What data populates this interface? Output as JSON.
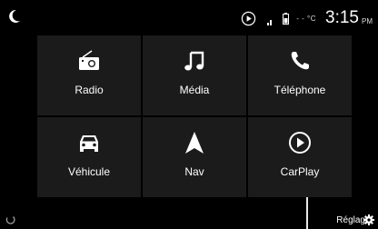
{
  "status": {
    "temp": "- - °C",
    "time": "3:15",
    "ampm": "PM"
  },
  "tiles": [
    {
      "label": "Radio",
      "icon": "radio-icon"
    },
    {
      "label": "Média",
      "icon": "music-note-icon"
    },
    {
      "label": "Téléphone",
      "icon": "phone-icon"
    },
    {
      "label": "Véhicule",
      "icon": "car-icon"
    },
    {
      "label": "Nav",
      "icon": "navigation-arrow-icon"
    },
    {
      "label": "CarPlay",
      "icon": "carplay-icon"
    }
  ],
  "bottom": {
    "settings_label": "Réglag"
  },
  "colors": {
    "background": "#000000",
    "tile": "#1b1b1b",
    "text": "#ffffff"
  }
}
